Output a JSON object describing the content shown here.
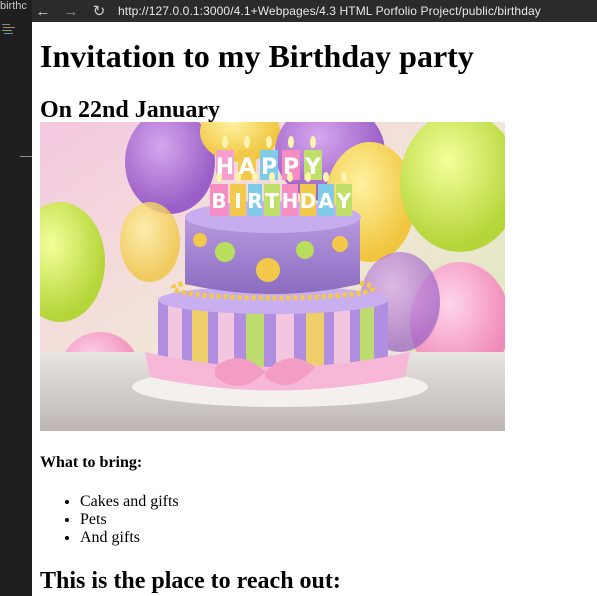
{
  "editor": {
    "tab_text": "birthc"
  },
  "browser": {
    "back_icon": "arrow-left-icon",
    "forward_icon": "arrow-right-icon",
    "reload_icon": "reload-icon",
    "url": "http://127.0.0.1:3000/4.1+Webpages/4.3 HTML Porfolio Project/public/birthday"
  },
  "page": {
    "title": "Invitation to my Birthday party",
    "date_heading": "On 22nd January",
    "image_banner_letters": [
      "H",
      "A",
      "P",
      "P",
      "Y",
      "B",
      "I",
      "R",
      "T",
      "H",
      "D",
      "A",
      "Y"
    ],
    "bring_heading": "What to bring:",
    "bring_items": [
      "Cakes and gifts",
      "Pets",
      "And gifts"
    ],
    "reach_heading": "This is the place to reach out:"
  }
}
